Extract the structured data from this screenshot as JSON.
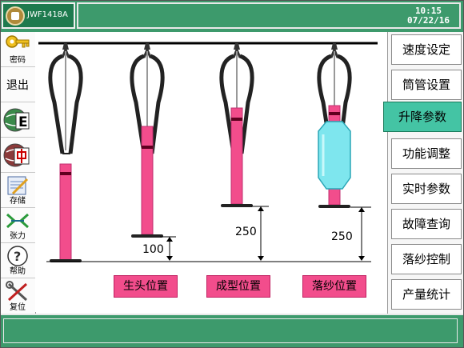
{
  "header": {
    "model": "JWF1418A",
    "time": "10:15",
    "date": "07/22/16"
  },
  "left_menu": [
    {
      "label": "密码",
      "icon": "key-icon"
    },
    {
      "label": "退出",
      "icon": ""
    },
    {
      "label": "",
      "icon": "globe-e-icon"
    },
    {
      "label": "",
      "icon": "globe-zh-icon"
    },
    {
      "label": "存储",
      "icon": "notepad-icon"
    },
    {
      "label": "张力",
      "icon": "tension-icon"
    },
    {
      "label": "帮助",
      "icon": "help-icon"
    },
    {
      "label": "复位",
      "icon": "tools-icon"
    }
  ],
  "right_menu": [
    {
      "label": "速度设定",
      "active": false
    },
    {
      "label": "筒管设置",
      "active": false
    },
    {
      "label": "升降参数",
      "active": true
    },
    {
      "label": "功能调整",
      "active": false
    },
    {
      "label": "实时参数",
      "active": false
    },
    {
      "label": "故障查询",
      "active": false
    },
    {
      "label": "落纱控制",
      "active": false
    },
    {
      "label": "产量统计",
      "active": false
    }
  ],
  "positions": {
    "start": "生头位置",
    "forming": "成型位置",
    "doffing": "落纱位置"
  },
  "measurements": {
    "start_height": "100",
    "forming_height": "250",
    "doffing_height": "250"
  },
  "colors": {
    "header_green": "#3d9a6c",
    "accent_teal": "#44c4a4",
    "bobbin_pink": "#f24d8c",
    "yarn_cyan": "#7ee6ee"
  }
}
